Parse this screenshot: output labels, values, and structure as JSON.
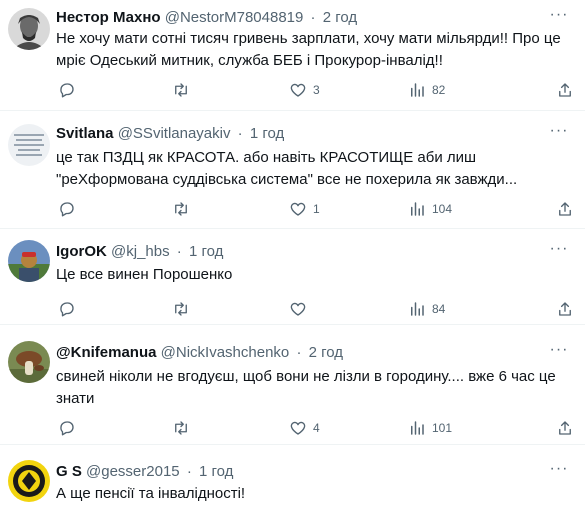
{
  "tweets": [
    {
      "name": "Нестор Махно",
      "handle": "@NestorM78048819",
      "time": "2 год",
      "text": "Не хочу мати сотні тисяч гривень зарплати, хочу мати мільярди!! Про це\nмріє Одеський митник, служба БЕБ і Прокурор-інвалід!!",
      "likes": "3",
      "views": "82",
      "avatar_icon": "portrait-avatar"
    },
    {
      "name": "Svitlana",
      "handle": "@SSvitlanayakiv",
      "time": "1 год",
      "text": "це так ПЗДЦ як КРАСОТА. або навіть КРАСОТИЩЕ аби лиш\n\"реХформована суддівська система\" все не похерила як завжди...",
      "likes": "1",
      "views": "104",
      "avatar_icon": "text-image-avatar"
    },
    {
      "name": "IgorOK",
      "handle": "@kj_hbs",
      "time": "1 год",
      "text": "Це все винен Порошенко",
      "likes": "",
      "views": "84",
      "avatar_icon": "landscape-avatar"
    },
    {
      "name": "@Knifemanua",
      "handle": "@NickIvashchenko",
      "time": "2 год",
      "text": "свиней ніколи не вгодуєш, щоб вони  не лізли в городину.... вже 6 час це\nзнати",
      "likes": "4",
      "views": "101",
      "avatar_icon": "mushroom-avatar"
    },
    {
      "name": "G S",
      "handle": "@gesser2015",
      "time": "1 год",
      "text": "А ще пенсії та інвалідності!",
      "likes": "",
      "views": "",
      "avatar_icon": "emblem-avatar"
    }
  ]
}
